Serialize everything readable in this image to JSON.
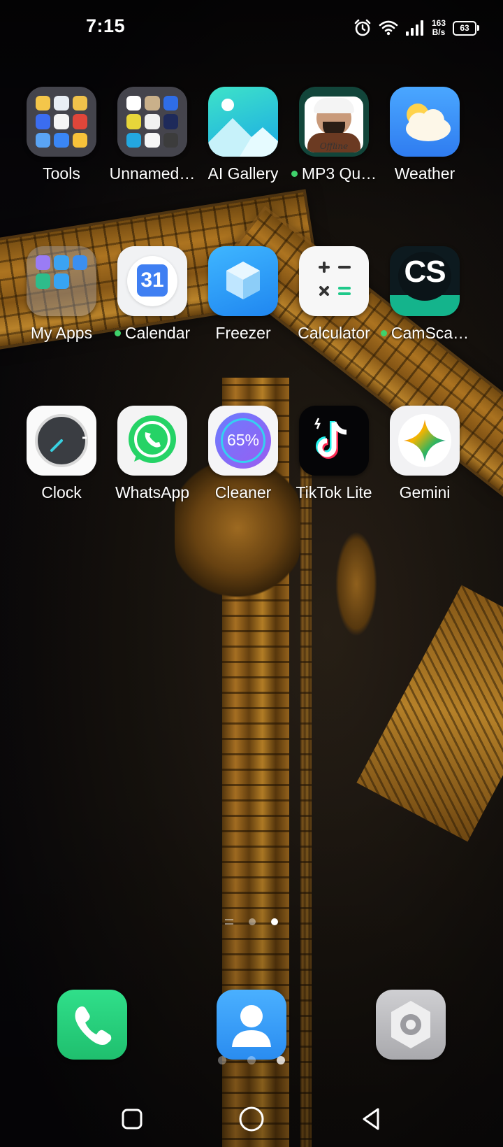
{
  "status_bar": {
    "time": "7:15",
    "net_speed_value": "163",
    "net_speed_unit": "B/s",
    "battery": "63",
    "icons": [
      "alarm-icon",
      "wifi-icon",
      "signal-icon",
      "battery-icon"
    ]
  },
  "apps": [
    {
      "label": "Tools",
      "type": "folder",
      "new": false
    },
    {
      "label": "Unnamed…",
      "type": "folder",
      "new": false
    },
    {
      "label": "AI Gallery",
      "icon": "gallery-icon",
      "new": false
    },
    {
      "label": "MP3 Qu…",
      "icon": "quran-offline-icon",
      "new": true
    },
    {
      "label": "Weather",
      "icon": "weather-icon",
      "new": false
    },
    {
      "label": "My Apps",
      "type": "folder",
      "new": false
    },
    {
      "label": "Calendar",
      "icon": "calendar-icon",
      "new": true,
      "badge": "31"
    },
    {
      "label": "Freezer",
      "icon": "freezer-icon",
      "new": false
    },
    {
      "label": "Calculator",
      "icon": "calculator-icon",
      "new": false
    },
    {
      "label": "CamSca…",
      "icon": "camscanner-icon",
      "new": true,
      "badge": "CS"
    },
    {
      "label": "Clock",
      "icon": "clock-icon",
      "new": false
    },
    {
      "label": "WhatsApp",
      "icon": "whatsapp-icon",
      "new": false
    },
    {
      "label": "Cleaner",
      "icon": "cleaner-icon",
      "new": false,
      "badge": "65%"
    },
    {
      "label": "TikTok Lite",
      "icon": "tiktok-icon",
      "new": false
    },
    {
      "label": "Gemini",
      "icon": "gemini-icon",
      "new": false
    }
  ],
  "mp3_icon_caption": "Offline",
  "dock": [
    {
      "name": "Phone",
      "icon": "phone-icon"
    },
    {
      "name": "Contacts",
      "icon": "contacts-icon"
    },
    {
      "name": "Settings",
      "icon": "settings-icon"
    }
  ],
  "pages": {
    "count": 2,
    "active": 2
  },
  "nav": [
    "recents",
    "home",
    "back"
  ],
  "colors": {
    "new_dot": "#3fd16b",
    "whatsapp": "#25d366",
    "phone": "#2bd27e",
    "contacts": "#3a9bf5",
    "camscanner": "#14b48c"
  }
}
